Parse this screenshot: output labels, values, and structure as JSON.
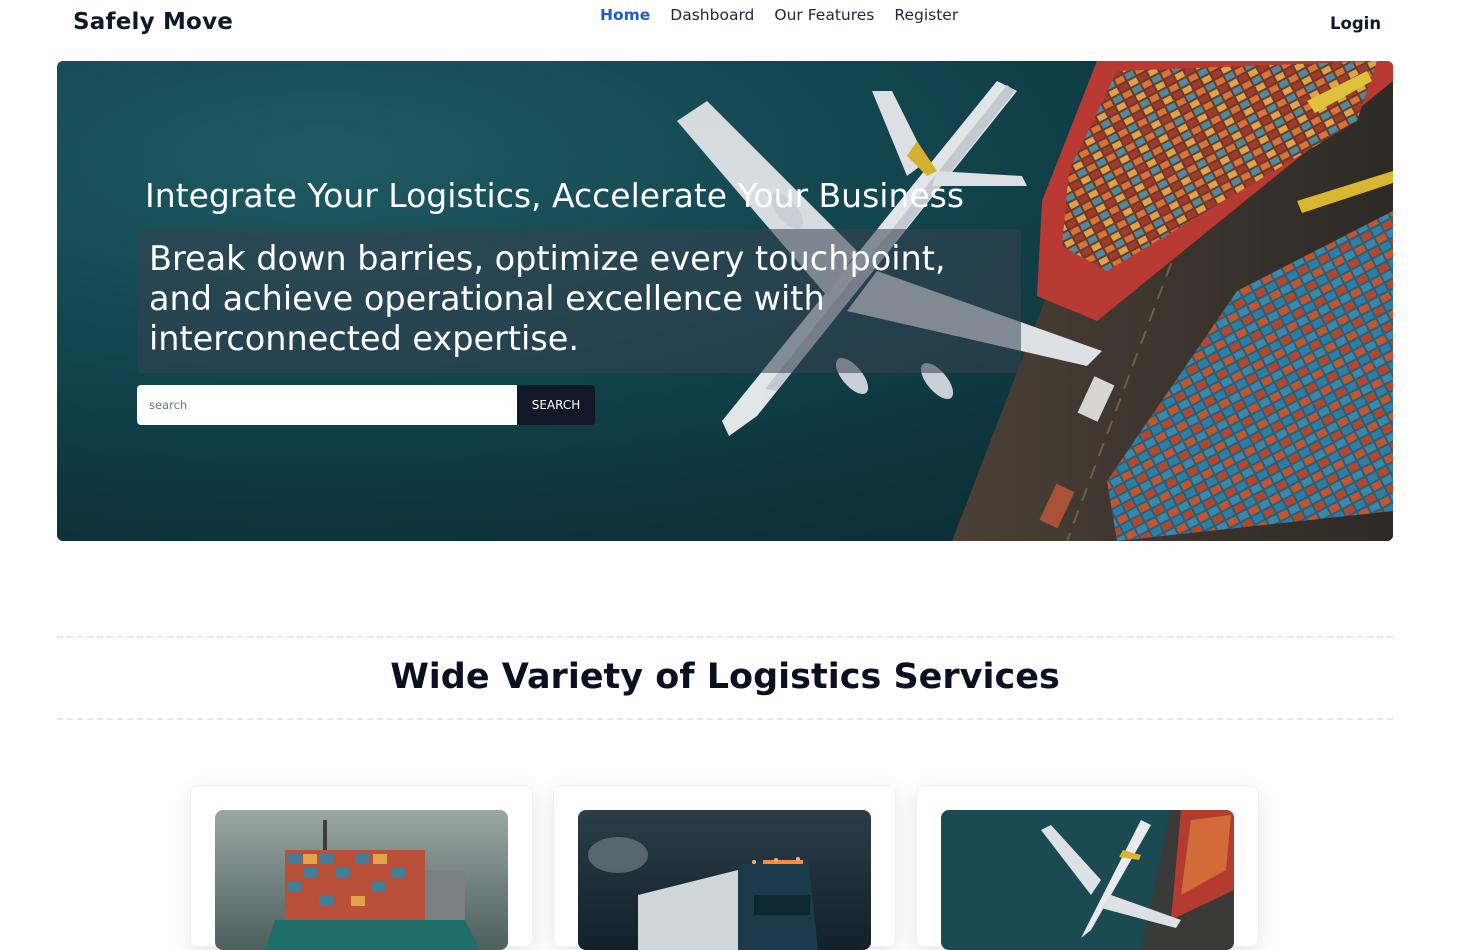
{
  "brand": "Safely Move",
  "nav": {
    "home": "Home",
    "dashboard": "Dashboard",
    "features": "Our Features",
    "register": "Register",
    "login": "Login"
  },
  "hero": {
    "title": "Integrate Your Logistics, Accelerate Your Business",
    "subtitle": "Break down barries, optimize every touchpoint, and achieve operational excellence with interconnected expertise.",
    "search_placeholder": "search",
    "search_button": "SEARCH"
  },
  "services": {
    "title": "Wide Variety of Logistics Services",
    "cards": [
      {
        "image": "cargo-ship-image"
      },
      {
        "image": "truck-image"
      },
      {
        "image": "airplane-port-image"
      }
    ]
  },
  "colors": {
    "accent": "#1d5fbf",
    "dark": "#111827",
    "hero_bg": "#134750"
  }
}
